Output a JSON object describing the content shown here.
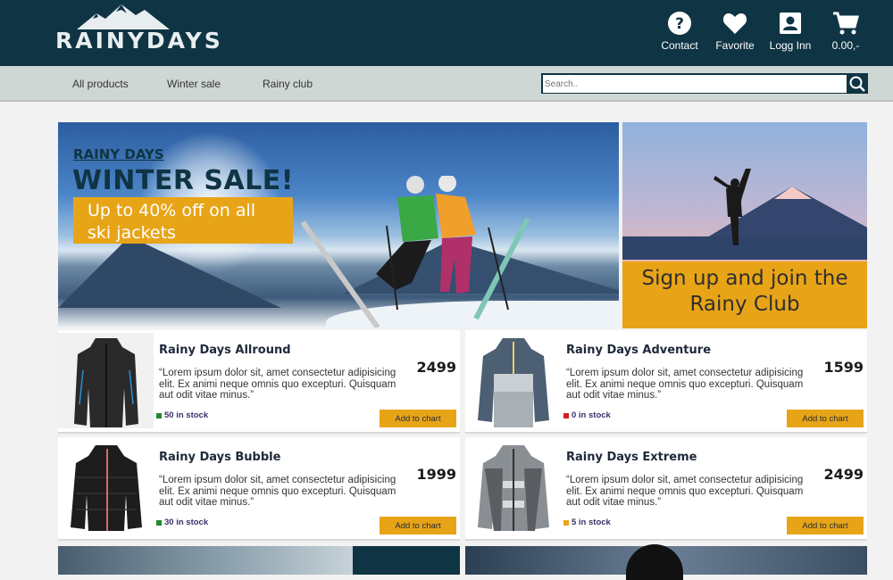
{
  "brand": {
    "name": "RAINYDAYS"
  },
  "header": {
    "icons": [
      {
        "name": "help-icon",
        "label": "Contact"
      },
      {
        "name": "heart-icon",
        "label": "Favorite"
      },
      {
        "name": "account-icon",
        "label": "Logg Inn"
      },
      {
        "name": "cart-icon",
        "label": "0.00,-"
      }
    ]
  },
  "subnav": {
    "links": [
      "All products",
      "Winter sale",
      "Rainy club"
    ],
    "search_placeholder": "Search.."
  },
  "hero": {
    "label": "RAINY DAYS",
    "title": "WINTER SALE!",
    "offer_line1": "Up to 40% off on all",
    "offer_line2": "ski jackets"
  },
  "club": {
    "line1": "Sign up and join the",
    "line2": "Rainy Club"
  },
  "products": [
    {
      "name": "Rainy Days Allround",
      "desc_line1": "“Lorem ipsum dolor sit, amet consectetur adipisicing",
      "desc_line2": "elit. Ex animi neque omnis quo excepturi. Quisquam",
      "desc_line3": "aut odit vitae minus.”",
      "price": "2499",
      "stock": "50 in stock",
      "stock_color": "#1f8a2e",
      "button": "Add to chart"
    },
    {
      "name": "Rainy Days Adventure",
      "desc_line1": "“Lorem ipsum dolor sit, amet consectetur adipisicing",
      "desc_line2": "elit. Ex animi neque omnis quo excepturi. Quisquam",
      "desc_line3": "aut odit vitae minus.”",
      "price": "1599",
      "stock": "0 in stock",
      "stock_color": "#d11f1f",
      "button": "Add to chart"
    },
    {
      "name": "Rainy Days Bubble",
      "desc_line1": "“Lorem ipsum dolor sit, amet consectetur adipisicing",
      "desc_line2": "elit. Ex animi neque omnis quo excepturi. Quisquam",
      "desc_line3": "aut odit vitae minus.”",
      "price": "1999",
      "stock": "30 in stock",
      "stock_color": "#1f8a2e",
      "button": "Add to chart"
    },
    {
      "name": "Rainy Days Extreme",
      "desc_line1": "“Lorem ipsum dolor sit, amet consectetur adipisicing",
      "desc_line2": "elit. Ex animi neque omnis quo excepturi. Quisquam",
      "desc_line3": "aut odit vitae minus.”",
      "price": "2499",
      "stock": "5 in stock",
      "stock_color": "#e8a417",
      "button": "Add to chart"
    }
  ],
  "colors": {
    "header_bg": "#0f3443",
    "subnav_bg": "#cfd7d4",
    "accent": "#e8a417"
  }
}
